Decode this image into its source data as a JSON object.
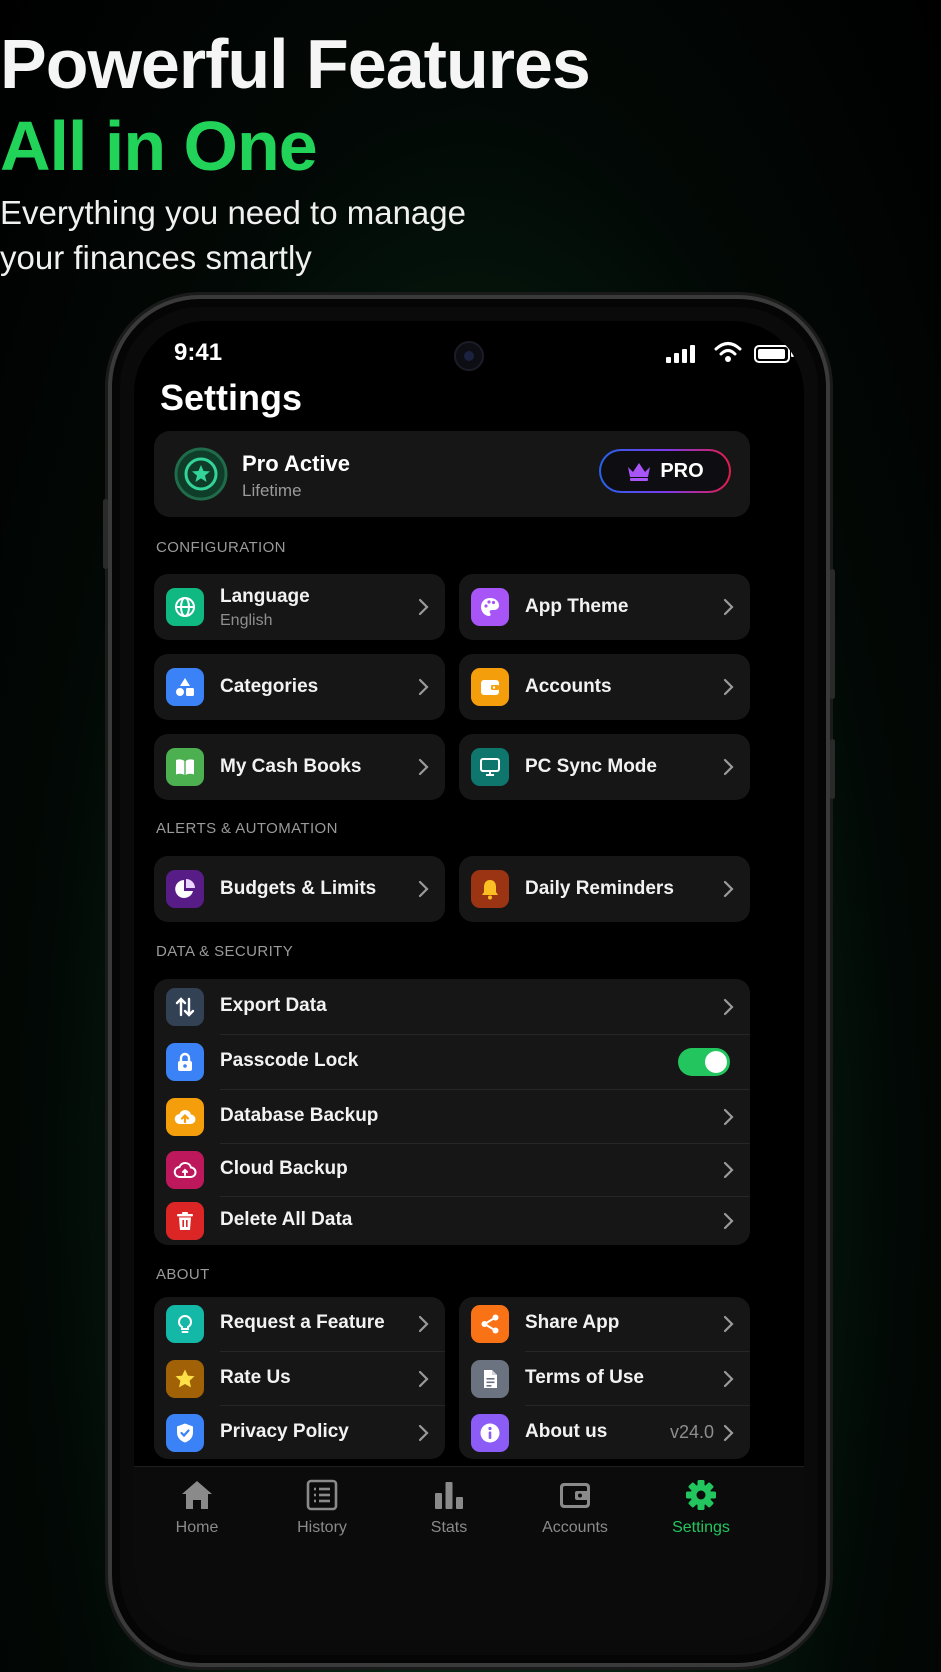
{
  "hero": {
    "line1": "Powerful Features",
    "line2": "All in One",
    "subtitle_line1": "Everything you need to manage",
    "subtitle_line2": "your finances smartly"
  },
  "status": {
    "time": "9:41"
  },
  "page_title": "Settings",
  "pro": {
    "title": "Pro Active",
    "subtitle": "Lifetime",
    "badge_label": "PRO"
  },
  "sections": {
    "configuration": "CONFIGURATION",
    "alerts": "ALERTS & AUTOMATION",
    "data_security": "DATA & SECURITY",
    "about": "ABOUT"
  },
  "configuration": {
    "language": {
      "label": "Language",
      "value": "English",
      "icon": "globe-icon",
      "color": "#10b981"
    },
    "app_theme": {
      "label": "App Theme",
      "icon": "palette-icon",
      "color": "#a855f7"
    },
    "categories": {
      "label": "Categories",
      "icon": "shapes-icon",
      "color": "#3b82f6"
    },
    "accounts": {
      "label": "Accounts",
      "icon": "wallet-icon",
      "color": "#f59e0b"
    },
    "cash_books": {
      "label": "My Cash Books",
      "icon": "book-icon",
      "color": "#4caf50"
    },
    "pc_sync": {
      "label": "PC Sync Mode",
      "icon": "monitor-icon",
      "color": "#0f766e"
    }
  },
  "alerts": {
    "budgets": {
      "label": "Budgets & Limits",
      "icon": "pie-chart-icon",
      "color": "#581c87"
    },
    "reminders": {
      "label": "Daily Reminders",
      "icon": "bell-icon",
      "color": "#9a3412"
    }
  },
  "data_security": {
    "export": {
      "label": "Export Data",
      "icon": "arrows-updown-icon",
      "color": "#334155"
    },
    "passcode": {
      "label": "Passcode Lock",
      "icon": "lock-icon",
      "color": "#3b82f6",
      "enabled": true
    },
    "db_backup": {
      "label": "Database Backup",
      "icon": "cloud-upload-icon",
      "color": "#f59e0b"
    },
    "cloud_backup": {
      "label": "Cloud Backup",
      "icon": "cloud-icon",
      "color": "#be185d"
    },
    "delete_all": {
      "label": "Delete All Data",
      "icon": "trash-icon",
      "color": "#dc2626"
    }
  },
  "about": {
    "request_feature": {
      "label": "Request a Feature",
      "icon": "lightbulb-icon",
      "color": "#14b8a6"
    },
    "rate_us": {
      "label": "Rate Us",
      "icon": "star-icon",
      "color": "#a16207"
    },
    "privacy": {
      "label": "Privacy Policy",
      "icon": "shield-icon",
      "color": "#3b82f6"
    },
    "share": {
      "label": "Share App",
      "icon": "share-icon",
      "color": "#f97316"
    },
    "terms": {
      "label": "Terms of Use",
      "icon": "document-icon",
      "color": "#6b7280"
    },
    "about_us": {
      "label": "About us",
      "value": "v24.0",
      "icon": "info-icon",
      "color": "#8b5cf6"
    }
  },
  "tabs": [
    {
      "label": "Home",
      "icon": "home-icon"
    },
    {
      "label": "History",
      "icon": "list-icon"
    },
    {
      "label": "Stats",
      "icon": "bar-chart-icon"
    },
    {
      "label": "Accounts",
      "icon": "wallet-icon"
    },
    {
      "label": "Settings",
      "icon": "gear-icon",
      "active": true
    }
  ],
  "colors": {
    "accent": "#22c55e",
    "hero_green": "#22d35a",
    "card": "#161616"
  }
}
